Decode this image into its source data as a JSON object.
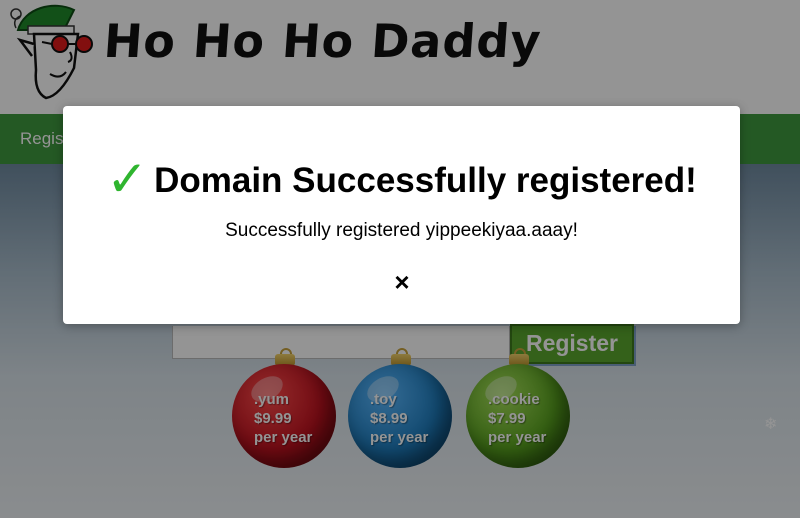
{
  "header": {
    "logo_text": "Ho Ho Ho Daddy",
    "logo_icon": "elf-mascot-icon"
  },
  "nav": {
    "items": [
      {
        "label": "Regis"
      }
    ]
  },
  "search": {
    "value": "",
    "placeholder": "",
    "register_label": "Register"
  },
  "ornaments": [
    {
      "tld": ".yum",
      "price": "$9.99",
      "period": "per year",
      "color": "#c1121f"
    },
    {
      "tld": ".toy",
      "price": "$8.99",
      "period": "per year",
      "color": "#1f7fc1"
    },
    {
      "tld": ".cookie",
      "price": "$7.99",
      "period": "per year",
      "color": "#5aa51f"
    }
  ],
  "modal": {
    "check_glyph": "✓",
    "title": "Domain Successfully registered!",
    "message": "Successfully registered yippeekiyaa.aaay!",
    "close_glyph": "×"
  },
  "colors": {
    "nav_green": "#3f9a3f",
    "check_green": "#2fb52f",
    "register_green": "#5aa82e"
  }
}
